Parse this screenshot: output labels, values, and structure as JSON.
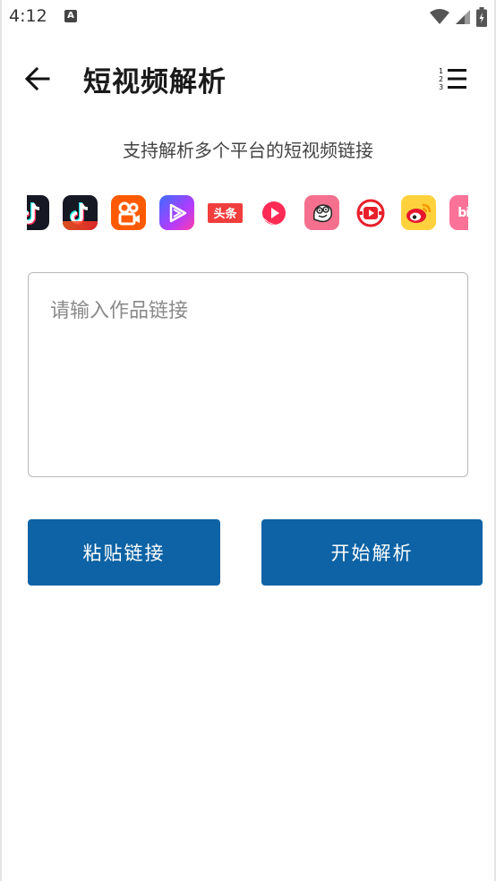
{
  "status": {
    "time": "4:12",
    "notification_icon": "a-icon",
    "wifi_icon": "wifi-icon",
    "signal_icon": "signal-icon",
    "battery_icon": "battery-icon"
  },
  "appbar": {
    "title": "短视频解析",
    "back_icon": "arrow-left-icon",
    "menu_icon": "numbered-list-icon"
  },
  "main": {
    "subtitle": "支持解析多个平台的短视频链接",
    "platforms": [
      {
        "icon": "douyin-icon",
        "color": "#1a1a1a"
      },
      {
        "icon": "douyin-icon",
        "color": "#1a1a1a"
      },
      {
        "icon": "kuaishou-icon",
        "color": "#ff5a00"
      },
      {
        "icon": "weishi-icon",
        "color": "#7b3cff"
      },
      {
        "icon": "toutiao-icon",
        "color": "#f13d3d"
      },
      {
        "icon": "xigua-icon",
        "color": "#ff2b54"
      },
      {
        "icon": "pipixia-icon",
        "color": "#f4708e"
      },
      {
        "icon": "huoshan-icon",
        "color": "#e8202c"
      },
      {
        "icon": "weibo-icon",
        "color": "#ffd23d"
      },
      {
        "icon": "bilibili-icon",
        "color": "#fb7299"
      }
    ],
    "input": {
      "placeholder": "请输入作品链接",
      "value": ""
    },
    "paste_button": "粘贴链接",
    "parse_button": "开始解析"
  },
  "colors": {
    "primary": "#0d63a5",
    "background": "#ffffff"
  }
}
